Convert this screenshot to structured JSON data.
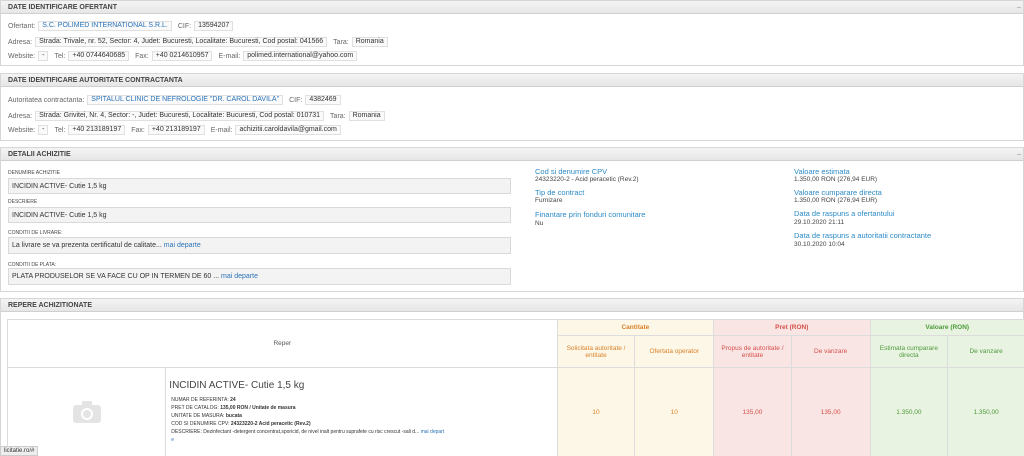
{
  "ofertant": {
    "header": "DATE IDENTIFICARE OFERTANT",
    "ofertant_label": "Ofertant:",
    "ofertant_value": "S.C. POLIMED INTERNATIONAL S.R.L.",
    "cif_label": "CIF:",
    "cif_value": "13594207",
    "adresa_label": "Adresa:",
    "adresa_value": "Strada: Trivale, nr. 52, Sector: 4, Judet: Bucuresti, Localitate: Bucuresti, Cod postal: 041566",
    "tara_label": "Tara:",
    "tara_value": "Romania",
    "website_label": "Website:",
    "website_value": "-",
    "tel_label": "Tel:",
    "tel_value": "+40 0744640685",
    "fax_label": "Fax:",
    "fax_value": "+40 0214610957",
    "email_label": "E-mail:",
    "email_value": "polimed.international@yahoo.com"
  },
  "autoritate": {
    "header": "DATE IDENTIFICARE AUTORITATE CONTRACTANTA",
    "autoritate_label": "Autoritatea contractanta:",
    "autoritate_value": "SPITALUL CLINIC DE NEFROLOGIE \"DR. CAROL DAVILA\"",
    "cif_label": "CIF:",
    "cif_value": "4382469",
    "adresa_label": "Adresa:",
    "adresa_value": "Strada: Grivitei, Nr. 4, Sector: -, Judet: Bucuresti, Localitate: Bucuresti, Cod postal: 010731",
    "tara_label": "Tara:",
    "tara_value": "Romania",
    "website_label": "Website:",
    "website_value": "-",
    "tel_label": "Tel:",
    "tel_value": "+40 213189197",
    "fax_label": "Fax:",
    "fax_value": "+40 213189197",
    "email_label": "E-mail:",
    "email_value": "achizitii.caroldavila@gmail.com"
  },
  "detalii": {
    "header": "DETALII ACHIZITIE",
    "denumire_label": "DENUMIRE ACHIZITIE",
    "denumire_value": "INCIDIN ACTIVE- Cutie 1,5 kg",
    "descriere_label": "DESCRIERE",
    "descriere_value": "INCIDIN ACTIVE- Cutie 1,5 kg",
    "livrare_label": "CONDITII DE LIVRARE:",
    "livrare_value": "La livrare se va prezenta certificatul de calitate...",
    "plata_label": "CONDITII DE PLATA:",
    "plata_value": "PLATA PRODUSELOR SE VA FACE CU OP IN TERMEN DE 60 ...",
    "more_label": "mai departe",
    "cpv_label": "Cod si denumire CPV",
    "cpv_value": "24323220-2 - Acid peracetic (Rev.2)",
    "tip_label": "Tip de contract",
    "tip_value": "Furnizare",
    "fonduri_label": "Finantare prin fonduri comunitare",
    "fonduri_value": "Nu",
    "val_estimata_label": "Valoare estimata",
    "val_estimata_value": "1.350,00 RON (276,94 EUR)",
    "val_directa_label": "Valoare cumparare directa",
    "val_directa_value": "1.350,00 RON (276,94 EUR)",
    "data_ofertant_label": "Data de raspuns a ofertantului",
    "data_ofertant_value": "29.10.2020 21:11",
    "data_autoritate_label": "Data de raspuns a autoritatii contractante",
    "data_autoritate_value": "30.10.2020 10:04"
  },
  "repere": {
    "header": "REPERE ACHIZITIONATE",
    "col_reper": "Reper",
    "col_cantitate": "Cantitate",
    "col_pret": "Pret (RON)",
    "col_valoare": "Valoare (RON)",
    "sub_solicitata": "Solicitata autoritate / entitate",
    "sub_ofertata": "Ofertata operator",
    "sub_propus": "Propus de autoritate / entitate",
    "sub_vanzare_pret": "De vanzare",
    "sub_estimata": "Estimata cumparare directa",
    "sub_vanzare_val": "De vanzare",
    "item": {
      "title": "INCIDIN ACTIVE- Cutie 1,5 kg",
      "nr_ref_label": "NUMAR DE REFERINTA:",
      "nr_ref_value": "24",
      "pret_catalog_label": "PRET DE CATALOG:",
      "pret_catalog_value": "135,00 RON / Unitate de masura",
      "unitate_label": "UNITATE DE MASURA:",
      "unitate_value": "bucata",
      "cpv_label": "COD SI DENUMIRE CPV:",
      "cpv_value": "24323220-2 Acid peracetic (Rev.2)",
      "descriere_label": "DESCRIERE:",
      "descriere_value": "Dezinfectant -detergent concentrat,sporicid, de nivel inalt pentru suprafete cu risc crescut -sali d...",
      "more_label": "mai depart",
      "more_tail": "e",
      "solicitata": "10",
      "ofertata": "10",
      "pret_propus": "135,00",
      "pret_vanzare": "135,00",
      "val_estimata": "1.350,00",
      "val_vanzare": "1.350,00"
    }
  },
  "status_url": "licitatie.ro/#"
}
